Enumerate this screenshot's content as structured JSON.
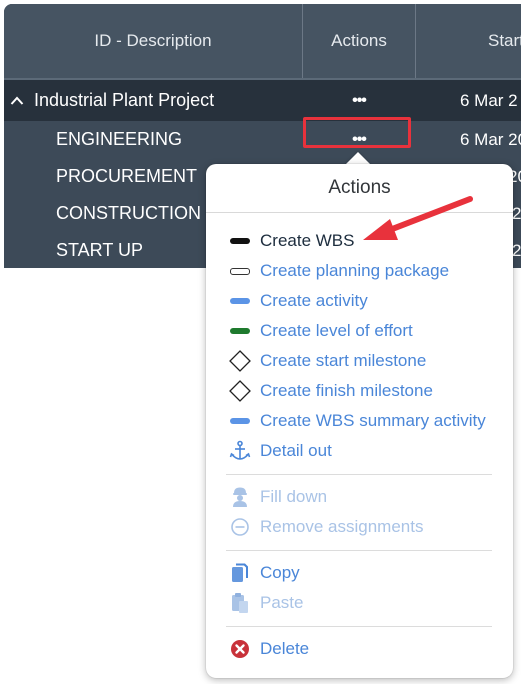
{
  "grid": {
    "columns": [
      "ID - Description",
      "Actions",
      "Start"
    ],
    "project": {
      "name": "Industrial Plant Project",
      "actions": "•••",
      "start": "6 Mar 2"
    },
    "rows": [
      {
        "name": "ENGINEERING",
        "actions": "•••",
        "start": "6 Mar 20"
      },
      {
        "name": "PROCUREMENT",
        "start": "20"
      },
      {
        "name": "CONSTRUCTION",
        "start": "2"
      },
      {
        "name": "START UP",
        "start": "2"
      }
    ]
  },
  "popover": {
    "title": "Actions",
    "group1": [
      {
        "label": "Create WBS",
        "icon": "black-bar-icon"
      },
      {
        "label": "Create planning package",
        "icon": "outline-bar-icon"
      },
      {
        "label": "Create activity",
        "icon": "blue-bar-icon"
      },
      {
        "label": "Create level of effort",
        "icon": "green-bar-icon"
      },
      {
        "label": "Create start milestone",
        "icon": "diamond-icon"
      },
      {
        "label": "Create finish milestone",
        "icon": "diamond-icon"
      },
      {
        "label": "Create WBS summary activity",
        "icon": "blue-bar-icon"
      },
      {
        "label": "Detail out",
        "icon": "anchor-icon"
      }
    ],
    "group2": [
      {
        "label": "Fill down",
        "icon": "worker-icon"
      },
      {
        "label": "Remove assignments",
        "icon": "minus-circle-icon"
      }
    ],
    "group3": [
      {
        "label": "Copy",
        "icon": "copy-icon"
      },
      {
        "label": "Paste",
        "icon": "paste-icon"
      }
    ],
    "group4": [
      {
        "label": "Delete",
        "icon": "delete-icon"
      }
    ]
  },
  "colors": {
    "grid_bg": "#3d4a58",
    "header_bg": "#465462",
    "project_row_bg": "#27313c",
    "link_blue": "#4a86d8",
    "highlight_red": "#e8323c",
    "delete_red": "#c8323a"
  }
}
